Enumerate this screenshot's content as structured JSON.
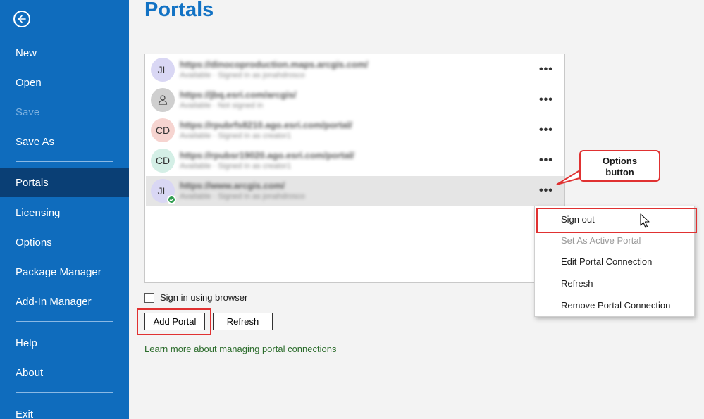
{
  "sidebar": {
    "items": [
      {
        "label": "New"
      },
      {
        "label": "Open"
      },
      {
        "label": "Save"
      },
      {
        "label": "Save As"
      },
      {
        "label": "Portals"
      },
      {
        "label": "Licensing"
      },
      {
        "label": "Options"
      },
      {
        "label": "Package Manager"
      },
      {
        "label": "Add-In Manager"
      },
      {
        "label": "Help"
      },
      {
        "label": "About"
      },
      {
        "label": "Exit"
      }
    ],
    "active": "Portals",
    "background": "#0f6cbd",
    "active_background": "#0a3f75"
  },
  "page": {
    "title": "Portals"
  },
  "portals": [
    {
      "initials": "JL",
      "url": "https://dinocoproduction.maps.arcgis.com/",
      "status": "Available · Signed in as jonahdrosco",
      "avatar_color": "#d9d7f4"
    },
    {
      "initials": "",
      "url": "https://jbq.esri.com/arcgis/",
      "status": "Available · Not signed in",
      "avatar_color": "#cfcfcf"
    },
    {
      "initials": "CD",
      "url": "https://rpubrfs8210.ago.esri.com/portal/",
      "status": "Available · Signed in as creator1",
      "avatar_color": "#f6d4d0"
    },
    {
      "initials": "CD",
      "url": "https://rpubsr19020.ago.esri.com/portal/",
      "status": "Available · Signed in as creator1",
      "avatar_color": "#d4efe6"
    },
    {
      "initials": "JL",
      "url": "https://www.arcgis.com/",
      "status": "Available · Signed in as jonahdrosco",
      "avatar_color": "#d9d7f4"
    }
  ],
  "options_glyph": "•••",
  "signin_browser_label": "Sign in using browser",
  "buttons": {
    "add_portal": "Add Portal",
    "refresh": "Refresh"
  },
  "learn_more": "Learn more about managing portal connections",
  "callout": {
    "line1": "Options",
    "line2": "button"
  },
  "context_menu": [
    {
      "label": "Sign out",
      "enabled": true
    },
    {
      "label": "Set As Active Portal",
      "enabled": false
    },
    {
      "label": "Edit Portal Connection",
      "enabled": true
    },
    {
      "label": "Refresh",
      "enabled": true
    },
    {
      "label": "Remove Portal Connection",
      "enabled": true
    }
  ],
  "icons": {
    "back": "back-arrow-icon",
    "user": "user-icon",
    "check": "check-icon",
    "cursor": "mouse-cursor-icon"
  },
  "colors": {
    "title": "#1272c4",
    "highlight": "#e03131",
    "link": "#2b6c2b"
  }
}
